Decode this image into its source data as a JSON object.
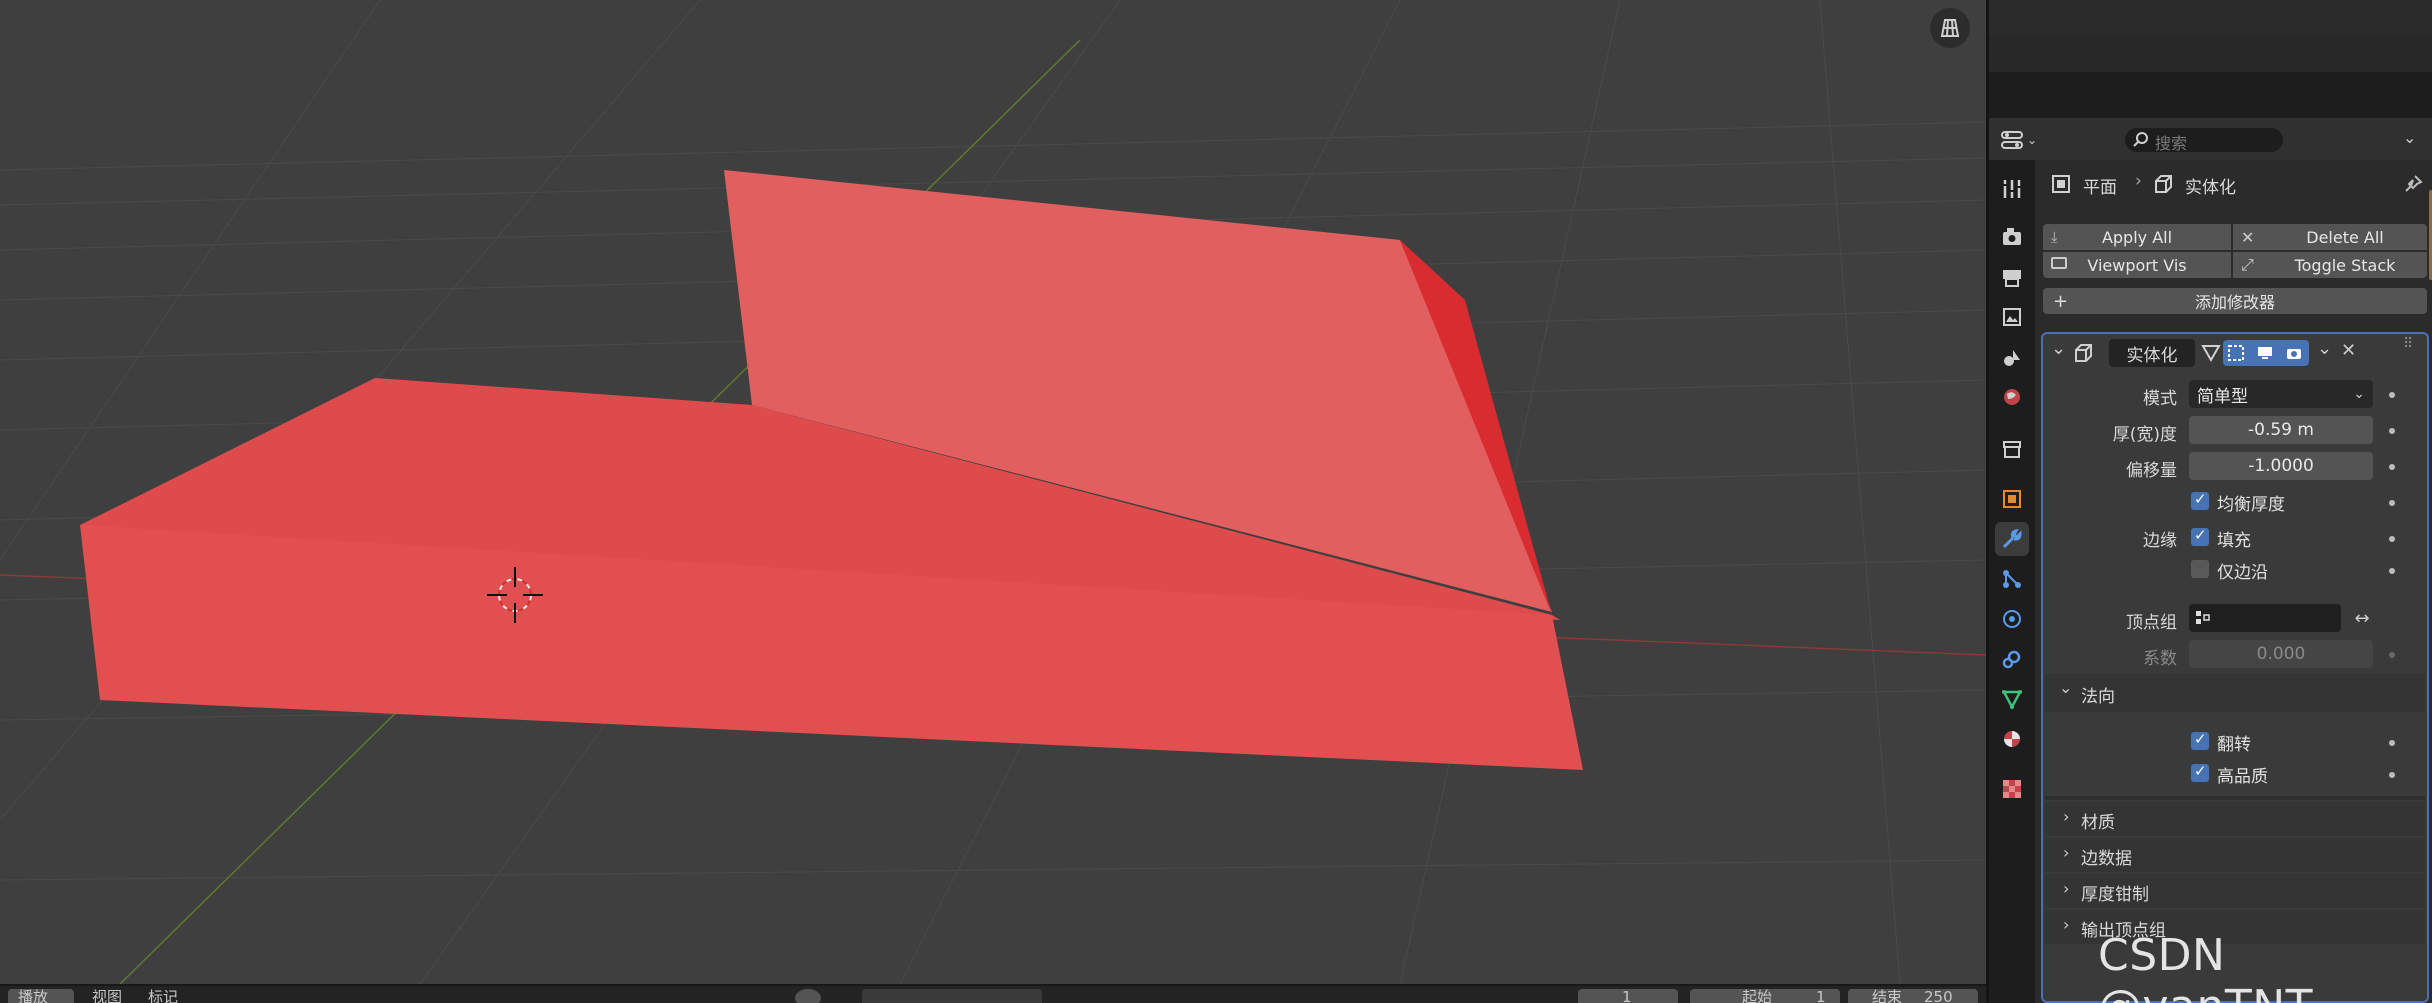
{
  "viewport": {
    "overlay_icon": "grid-icon"
  },
  "timeline": {
    "menu_items": [
      "播放",
      "视图",
      "标记"
    ],
    "current_frame": "1",
    "start_label": "起始",
    "start_value": "1",
    "end_label": "结束",
    "end_value": "250"
  },
  "properties": {
    "search_placeholder": "搜索",
    "breadcrumb": {
      "object": "平面",
      "modifier": "实体化"
    },
    "buttons": {
      "apply_all": "Apply All",
      "delete_all": "Delete All",
      "viewport_vis": "Viewport Vis",
      "toggle_stack": "Toggle Stack",
      "add_modifier": "添加修改器"
    },
    "modifier": {
      "name": "实体化",
      "mode_label": "模式",
      "mode_value": "简单型",
      "thickness_label": "厚(宽)度",
      "thickness_value": "-0.59 m",
      "offset_label": "偏移量",
      "offset_value": "-1.0000",
      "even_thickness_label": "均衡厚度",
      "even_thickness_checked": true,
      "rim_label": "边缘",
      "fill_label": "填充",
      "fill_checked": true,
      "only_rim_label": "仅边沿",
      "only_rim_checked": false,
      "vertex_group_label": "顶点组",
      "factor_label": "系数",
      "factor_value": "0.000",
      "normals_header": "法向",
      "flip_label": "翻转",
      "flip_checked": true,
      "high_quality_label": "高品质",
      "high_quality_checked": true,
      "collapsed_sections": [
        "材质",
        "边数据",
        "厚度钳制",
        "输出顶点组"
      ]
    }
  },
  "watermark": "CSDN @vanTNT",
  "colors": {
    "mesh_red": "#e25454",
    "accent_blue": "#4772b3",
    "panel_bg": "#2b2b2b"
  }
}
